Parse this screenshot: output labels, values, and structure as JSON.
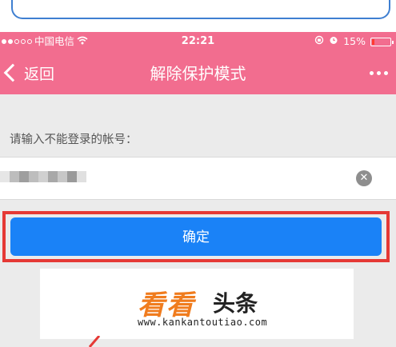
{
  "status_bar": {
    "carrier": "中国电信",
    "wifi_icon": "wifi-icon",
    "time": "22:21",
    "battery_percent": "15%",
    "battery_level": 0.15,
    "battery_color": "#ff3b30"
  },
  "nav": {
    "back_label": "返回",
    "title": "解除保护模式",
    "more_icon": "more-dots-icon"
  },
  "form": {
    "prompt": "请输入不能登录的帐号：",
    "account_value": "",
    "clear_icon": "clear-icon"
  },
  "confirm_label": "确定",
  "colors": {
    "header": "#f26d8f",
    "button": "#1a82f7",
    "highlight": "#e53935"
  },
  "watermark": {
    "brand_part1": "看看",
    "brand_part2": "头条",
    "url": "www.kankantoutiao.com"
  }
}
